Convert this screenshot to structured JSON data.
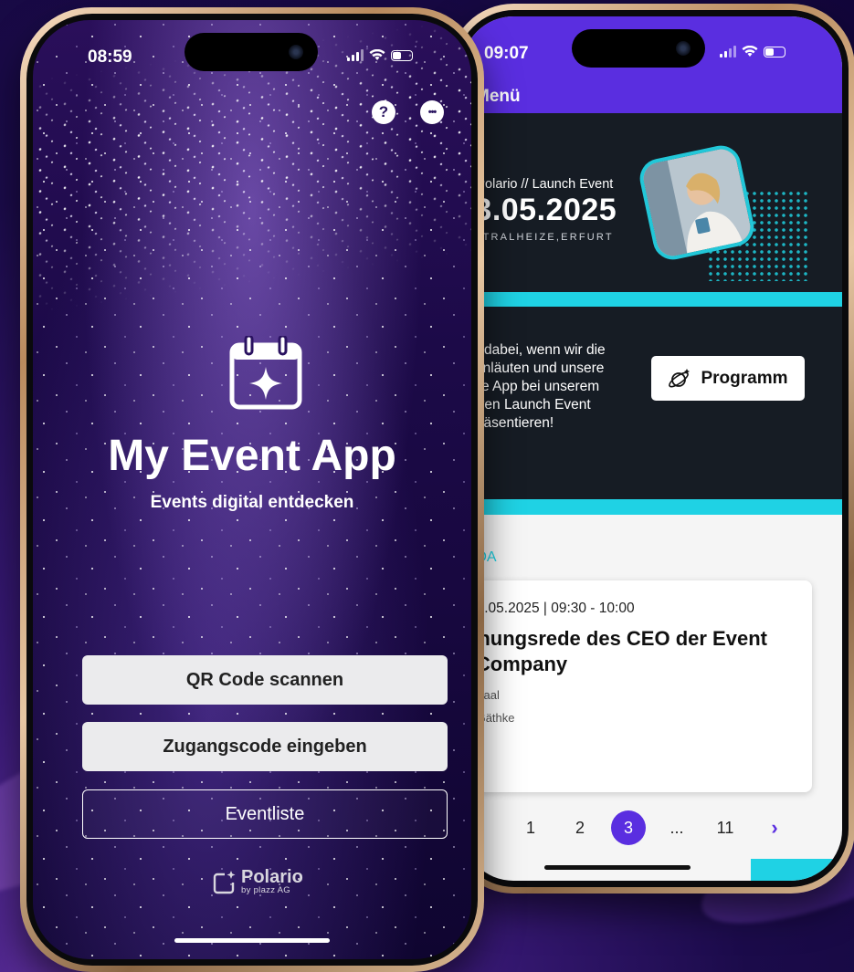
{
  "colors": {
    "accent_purple": "#5a2ee0",
    "accent_cyan": "#1fd2e4",
    "dark_panel": "#161c24",
    "bg_deep": "#1b0b4a"
  },
  "left_phone": {
    "status": {
      "time": "08:59"
    },
    "top_icons": {
      "help": "?",
      "more": "•••"
    },
    "app_title": "My Event App",
    "app_subtitle": "Events digital entdecken",
    "buttons": {
      "qr": "QR Code scannen",
      "code": "Zugangscode eingeben",
      "list": "Eventliste"
    },
    "logo": {
      "name": "Polario",
      "by": "by plazz AG"
    }
  },
  "right_phone": {
    "status": {
      "time": "09:07"
    },
    "nav": {
      "title": "Menü"
    },
    "banner": {
      "small": "My Polario // Launch Event",
      "date": "23.05.2025",
      "location": "ZENTRALHEIZE,ERFURT"
    },
    "welcome": {
      "text": "Seien Sie dabei, wenn wir die Zukunft einläuten und unsere innovative App bei unserem exklusiven Launch Event präsentieren!"
    },
    "program_button": "Programm",
    "agenda_label": "AGENDA",
    "card": {
      "date": "23.05.2025 | 09:30 - 10:00",
      "title": "Eröffnungsrede des CEO der Event App Company",
      "location": "Kesselsaal",
      "speaker": "Heino Gäthke"
    },
    "pagination": {
      "prev": "‹",
      "pages": [
        "1",
        "2",
        "3",
        "...",
        "11"
      ],
      "current": "3",
      "next": "›"
    }
  }
}
